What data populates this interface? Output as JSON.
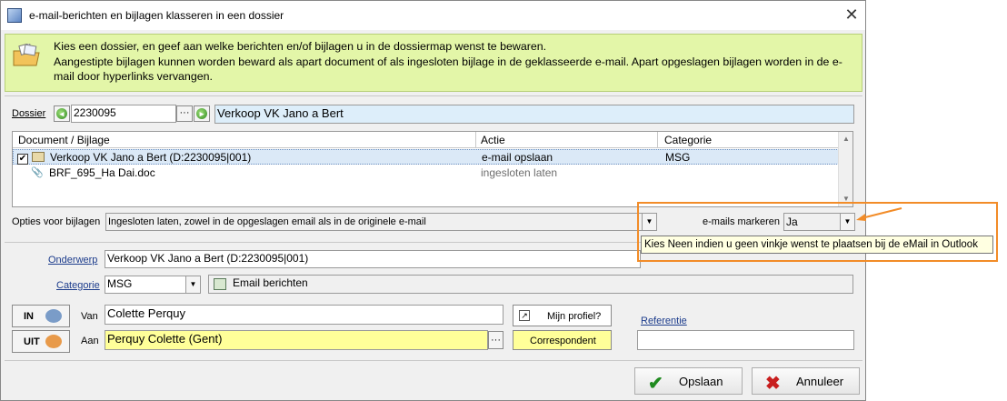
{
  "window": {
    "title": "e-mail-berichten en bijlagen klasseren in een dossier",
    "close_glyph": "✕"
  },
  "info": {
    "line1": "Kies een dossier, en geef aan welke berichten en/of bijlagen u in de dossiermap wenst te bewaren.",
    "line2": "Aangestipte bijlagen kunnen worden beward als apart document of als ingesloten bijlage in de geklasseerde e-mail. Apart opgeslagen bijlagen worden in de e-mail door hyperlinks vervangen."
  },
  "dossier": {
    "label": "Dossier",
    "number": "2230095",
    "ellipsis": "···",
    "name": "Verkoop VK Jano a Bert"
  },
  "grid": {
    "columns": [
      "Document / Bijlage",
      "Actie",
      "Categorie"
    ],
    "rows": [
      {
        "checked": true,
        "document": "Verkoop VK Jano a Bert (D:2230095|001)",
        "actie": "e-mail opslaan",
        "categorie": "MSG"
      },
      {
        "checked": false,
        "document": "BRF_695_Ha Dai.doc",
        "actie": "ingesloten laten",
        "categorie": ""
      }
    ]
  },
  "opties": {
    "label": "Opties voor bijlagen",
    "value": "Ingesloten laten, zowel in de opgeslagen email als in de originele e-mail"
  },
  "markeren": {
    "label": "e-mails markeren",
    "value": "Ja",
    "tooltip": "Kies Neen indien u geen vinkje wenst te plaatsen  bij de eMail in Outlook"
  },
  "onderwerp": {
    "label": "Onderwerp",
    "value": "Verkoop VK Jano a Bert (D:2230095|001)"
  },
  "categorie": {
    "label": "Categorie",
    "value": "MSG",
    "description": "Email berichten"
  },
  "van": {
    "in_label": "IN",
    "label": "Van",
    "value": "Colette Perquy",
    "profile_button": "Mijn profiel?"
  },
  "aan": {
    "uit_label": "UIT",
    "label": "Aan",
    "value": "Perquy Colette (Gent)",
    "ellipsis": "···",
    "correspondent_button": "Correspondent"
  },
  "referentie": {
    "label": "Referentie",
    "value": ""
  },
  "buttons": {
    "save": "Opslaan",
    "cancel": "Annuleer"
  },
  "colors": {
    "info_bg": "#e3f6a8",
    "highlight_yellow": "#ffff99",
    "dossier_blue": "#ddeefa",
    "annotation_orange": "#f28c28",
    "save_check": "#1f8a1f",
    "cancel_x": "#c81e1e"
  }
}
